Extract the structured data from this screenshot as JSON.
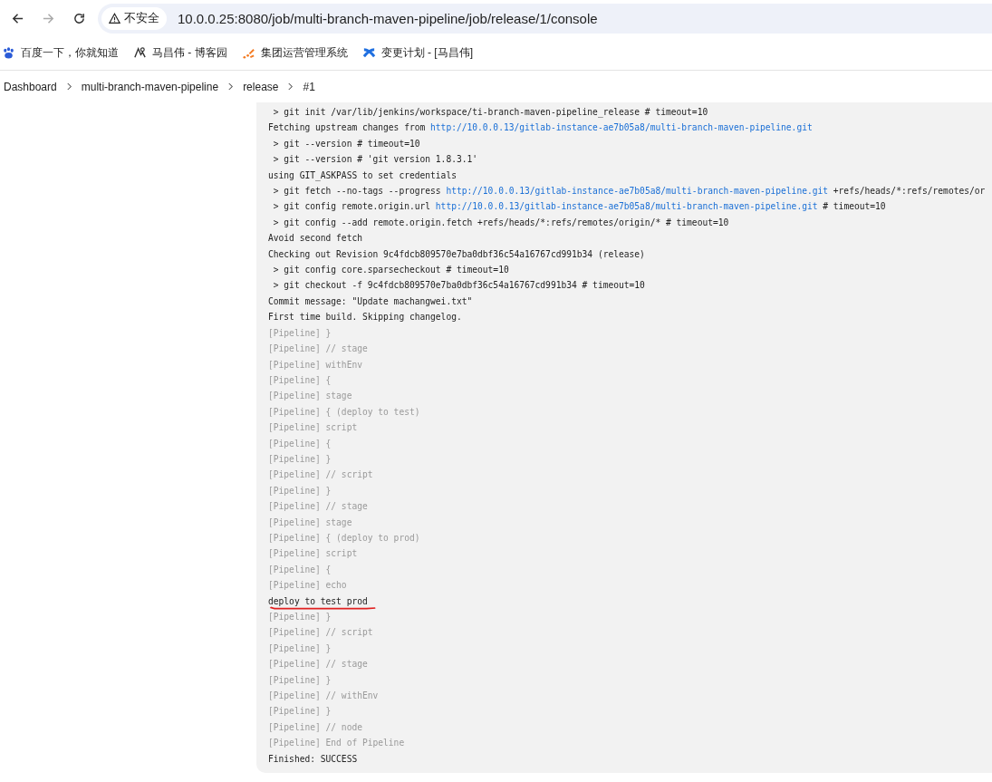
{
  "browser": {
    "not_secure_label": "不安全",
    "url": "10.0.0.25:8080/job/multi-branch-maven-pipeline/job/release/1/console"
  },
  "bookmarks": [
    {
      "kind": "paw",
      "label": "百度一下，你就知道"
    },
    {
      "kind": "blog",
      "label": "马昌伟 - 博客园"
    },
    {
      "kind": "dots",
      "label": "集团运营管理系统"
    },
    {
      "kind": "cross",
      "label": "变更计划 - [马昌伟]"
    }
  ],
  "breadcrumb": [
    "Dashboard",
    "multi-branch-maven-pipeline",
    "release",
    "#1"
  ],
  "console": {
    "lines": [
      {
        "kind": "output",
        "underlined": false,
        "parts": [
          {
            "kind": "text",
            "text": " > git init /var/lib/jenkins/workspace/ti-branch-maven-pipeline_release # timeout=10"
          }
        ]
      },
      {
        "kind": "output",
        "underlined": false,
        "parts": [
          {
            "kind": "text",
            "text": "Fetching upstream changes from "
          },
          {
            "kind": "link",
            "text": "http://10.0.0.13/gitlab-instance-ae7b05a8/multi-branch-maven-pipeline.git"
          }
        ]
      },
      {
        "kind": "output",
        "underlined": false,
        "parts": [
          {
            "kind": "text",
            "text": " > git --version # timeout=10"
          }
        ]
      },
      {
        "kind": "output",
        "underlined": false,
        "parts": [
          {
            "kind": "text",
            "text": " > git --version # 'git version 1.8.3.1'"
          }
        ]
      },
      {
        "kind": "output",
        "underlined": false,
        "parts": [
          {
            "kind": "text",
            "text": "using GIT_ASKPASS to set credentials"
          }
        ]
      },
      {
        "kind": "output",
        "underlined": false,
        "parts": [
          {
            "kind": "text",
            "text": " > git fetch --no-tags --progress "
          },
          {
            "kind": "link",
            "text": "http://10.0.0.13/gitlab-instance-ae7b05a8/multi-branch-maven-pipeline.git"
          },
          {
            "kind": "text",
            "text": " +refs/heads/*:refs/remotes/or"
          }
        ]
      },
      {
        "kind": "output",
        "underlined": false,
        "parts": [
          {
            "kind": "text",
            "text": " > git config remote.origin.url "
          },
          {
            "kind": "link",
            "text": "http://10.0.0.13/gitlab-instance-ae7b05a8/multi-branch-maven-pipeline.git"
          },
          {
            "kind": "text",
            "text": " # timeout=10"
          }
        ]
      },
      {
        "kind": "output",
        "underlined": false,
        "parts": [
          {
            "kind": "text",
            "text": " > git config --add remote.origin.fetch +refs/heads/*:refs/remotes/origin/* # timeout=10"
          }
        ]
      },
      {
        "kind": "output",
        "underlined": false,
        "parts": [
          {
            "kind": "text",
            "text": "Avoid second fetch"
          }
        ]
      },
      {
        "kind": "output",
        "underlined": false,
        "parts": [
          {
            "kind": "text",
            "text": "Checking out Revision 9c4fdcb809570e7ba0dbf36c54a16767cd991b34 (release)"
          }
        ]
      },
      {
        "kind": "output",
        "underlined": false,
        "parts": [
          {
            "kind": "text",
            "text": " > git config core.sparsecheckout # timeout=10"
          }
        ]
      },
      {
        "kind": "output",
        "underlined": false,
        "parts": [
          {
            "kind": "text",
            "text": " > git checkout -f 9c4fdcb809570e7ba0dbf36c54a16767cd991b34 # timeout=10"
          }
        ]
      },
      {
        "kind": "output",
        "underlined": false,
        "parts": [
          {
            "kind": "text",
            "text": "Commit message: \"Update machangwei.txt\""
          }
        ]
      },
      {
        "kind": "output",
        "underlined": false,
        "parts": [
          {
            "kind": "text",
            "text": "First time build. Skipping changelog."
          }
        ]
      },
      {
        "kind": "pipeline",
        "underlined": false,
        "parts": [
          {
            "kind": "text",
            "text": "[Pipeline] }"
          }
        ]
      },
      {
        "kind": "pipeline",
        "underlined": false,
        "parts": [
          {
            "kind": "text",
            "text": "[Pipeline] // stage"
          }
        ]
      },
      {
        "kind": "pipeline",
        "underlined": false,
        "parts": [
          {
            "kind": "text",
            "text": "[Pipeline] withEnv"
          }
        ]
      },
      {
        "kind": "pipeline",
        "underlined": false,
        "parts": [
          {
            "kind": "text",
            "text": "[Pipeline] {"
          }
        ]
      },
      {
        "kind": "pipeline",
        "underlined": false,
        "parts": [
          {
            "kind": "text",
            "text": "[Pipeline] stage"
          }
        ]
      },
      {
        "kind": "pipeline",
        "underlined": false,
        "parts": [
          {
            "kind": "text",
            "text": "[Pipeline] { (deploy to test)"
          }
        ]
      },
      {
        "kind": "pipeline",
        "underlined": false,
        "parts": [
          {
            "kind": "text",
            "text": "[Pipeline] script"
          }
        ]
      },
      {
        "kind": "pipeline",
        "underlined": false,
        "parts": [
          {
            "kind": "text",
            "text": "[Pipeline] {"
          }
        ]
      },
      {
        "kind": "pipeline",
        "underlined": false,
        "parts": [
          {
            "kind": "text",
            "text": "[Pipeline] }"
          }
        ]
      },
      {
        "kind": "pipeline",
        "underlined": false,
        "parts": [
          {
            "kind": "text",
            "text": "[Pipeline] // script"
          }
        ]
      },
      {
        "kind": "pipeline",
        "underlined": false,
        "parts": [
          {
            "kind": "text",
            "text": "[Pipeline] }"
          }
        ]
      },
      {
        "kind": "pipeline",
        "underlined": false,
        "parts": [
          {
            "kind": "text",
            "text": "[Pipeline] // stage"
          }
        ]
      },
      {
        "kind": "pipeline",
        "underlined": false,
        "parts": [
          {
            "kind": "text",
            "text": "[Pipeline] stage"
          }
        ]
      },
      {
        "kind": "pipeline",
        "underlined": false,
        "parts": [
          {
            "kind": "text",
            "text": "[Pipeline] { (deploy to prod)"
          }
        ]
      },
      {
        "kind": "pipeline",
        "underlined": false,
        "parts": [
          {
            "kind": "text",
            "text": "[Pipeline] script"
          }
        ]
      },
      {
        "kind": "pipeline",
        "underlined": false,
        "parts": [
          {
            "kind": "text",
            "text": "[Pipeline] {"
          }
        ]
      },
      {
        "kind": "pipeline",
        "underlined": false,
        "parts": [
          {
            "kind": "text",
            "text": "[Pipeline] echo"
          }
        ]
      },
      {
        "kind": "output",
        "underlined": true,
        "parts": [
          {
            "kind": "text",
            "text": "deploy to test prod"
          }
        ]
      },
      {
        "kind": "pipeline",
        "underlined": false,
        "parts": [
          {
            "kind": "text",
            "text": "[Pipeline] }"
          }
        ]
      },
      {
        "kind": "pipeline",
        "underlined": false,
        "parts": [
          {
            "kind": "text",
            "text": "[Pipeline] // script"
          }
        ]
      },
      {
        "kind": "pipeline",
        "underlined": false,
        "parts": [
          {
            "kind": "text",
            "text": "[Pipeline] }"
          }
        ]
      },
      {
        "kind": "pipeline",
        "underlined": false,
        "parts": [
          {
            "kind": "text",
            "text": "[Pipeline] // stage"
          }
        ]
      },
      {
        "kind": "pipeline",
        "underlined": false,
        "parts": [
          {
            "kind": "text",
            "text": "[Pipeline] }"
          }
        ]
      },
      {
        "kind": "pipeline",
        "underlined": false,
        "parts": [
          {
            "kind": "text",
            "text": "[Pipeline] // withEnv"
          }
        ]
      },
      {
        "kind": "pipeline",
        "underlined": false,
        "parts": [
          {
            "kind": "text",
            "text": "[Pipeline] }"
          }
        ]
      },
      {
        "kind": "pipeline",
        "underlined": false,
        "parts": [
          {
            "kind": "text",
            "text": "[Pipeline] // node"
          }
        ]
      },
      {
        "kind": "pipeline",
        "underlined": false,
        "parts": [
          {
            "kind": "text",
            "text": "[Pipeline] End of Pipeline"
          }
        ]
      },
      {
        "kind": "output",
        "underlined": false,
        "parts": [
          {
            "kind": "text",
            "text": "Finished: SUCCESS"
          }
        ]
      }
    ]
  }
}
